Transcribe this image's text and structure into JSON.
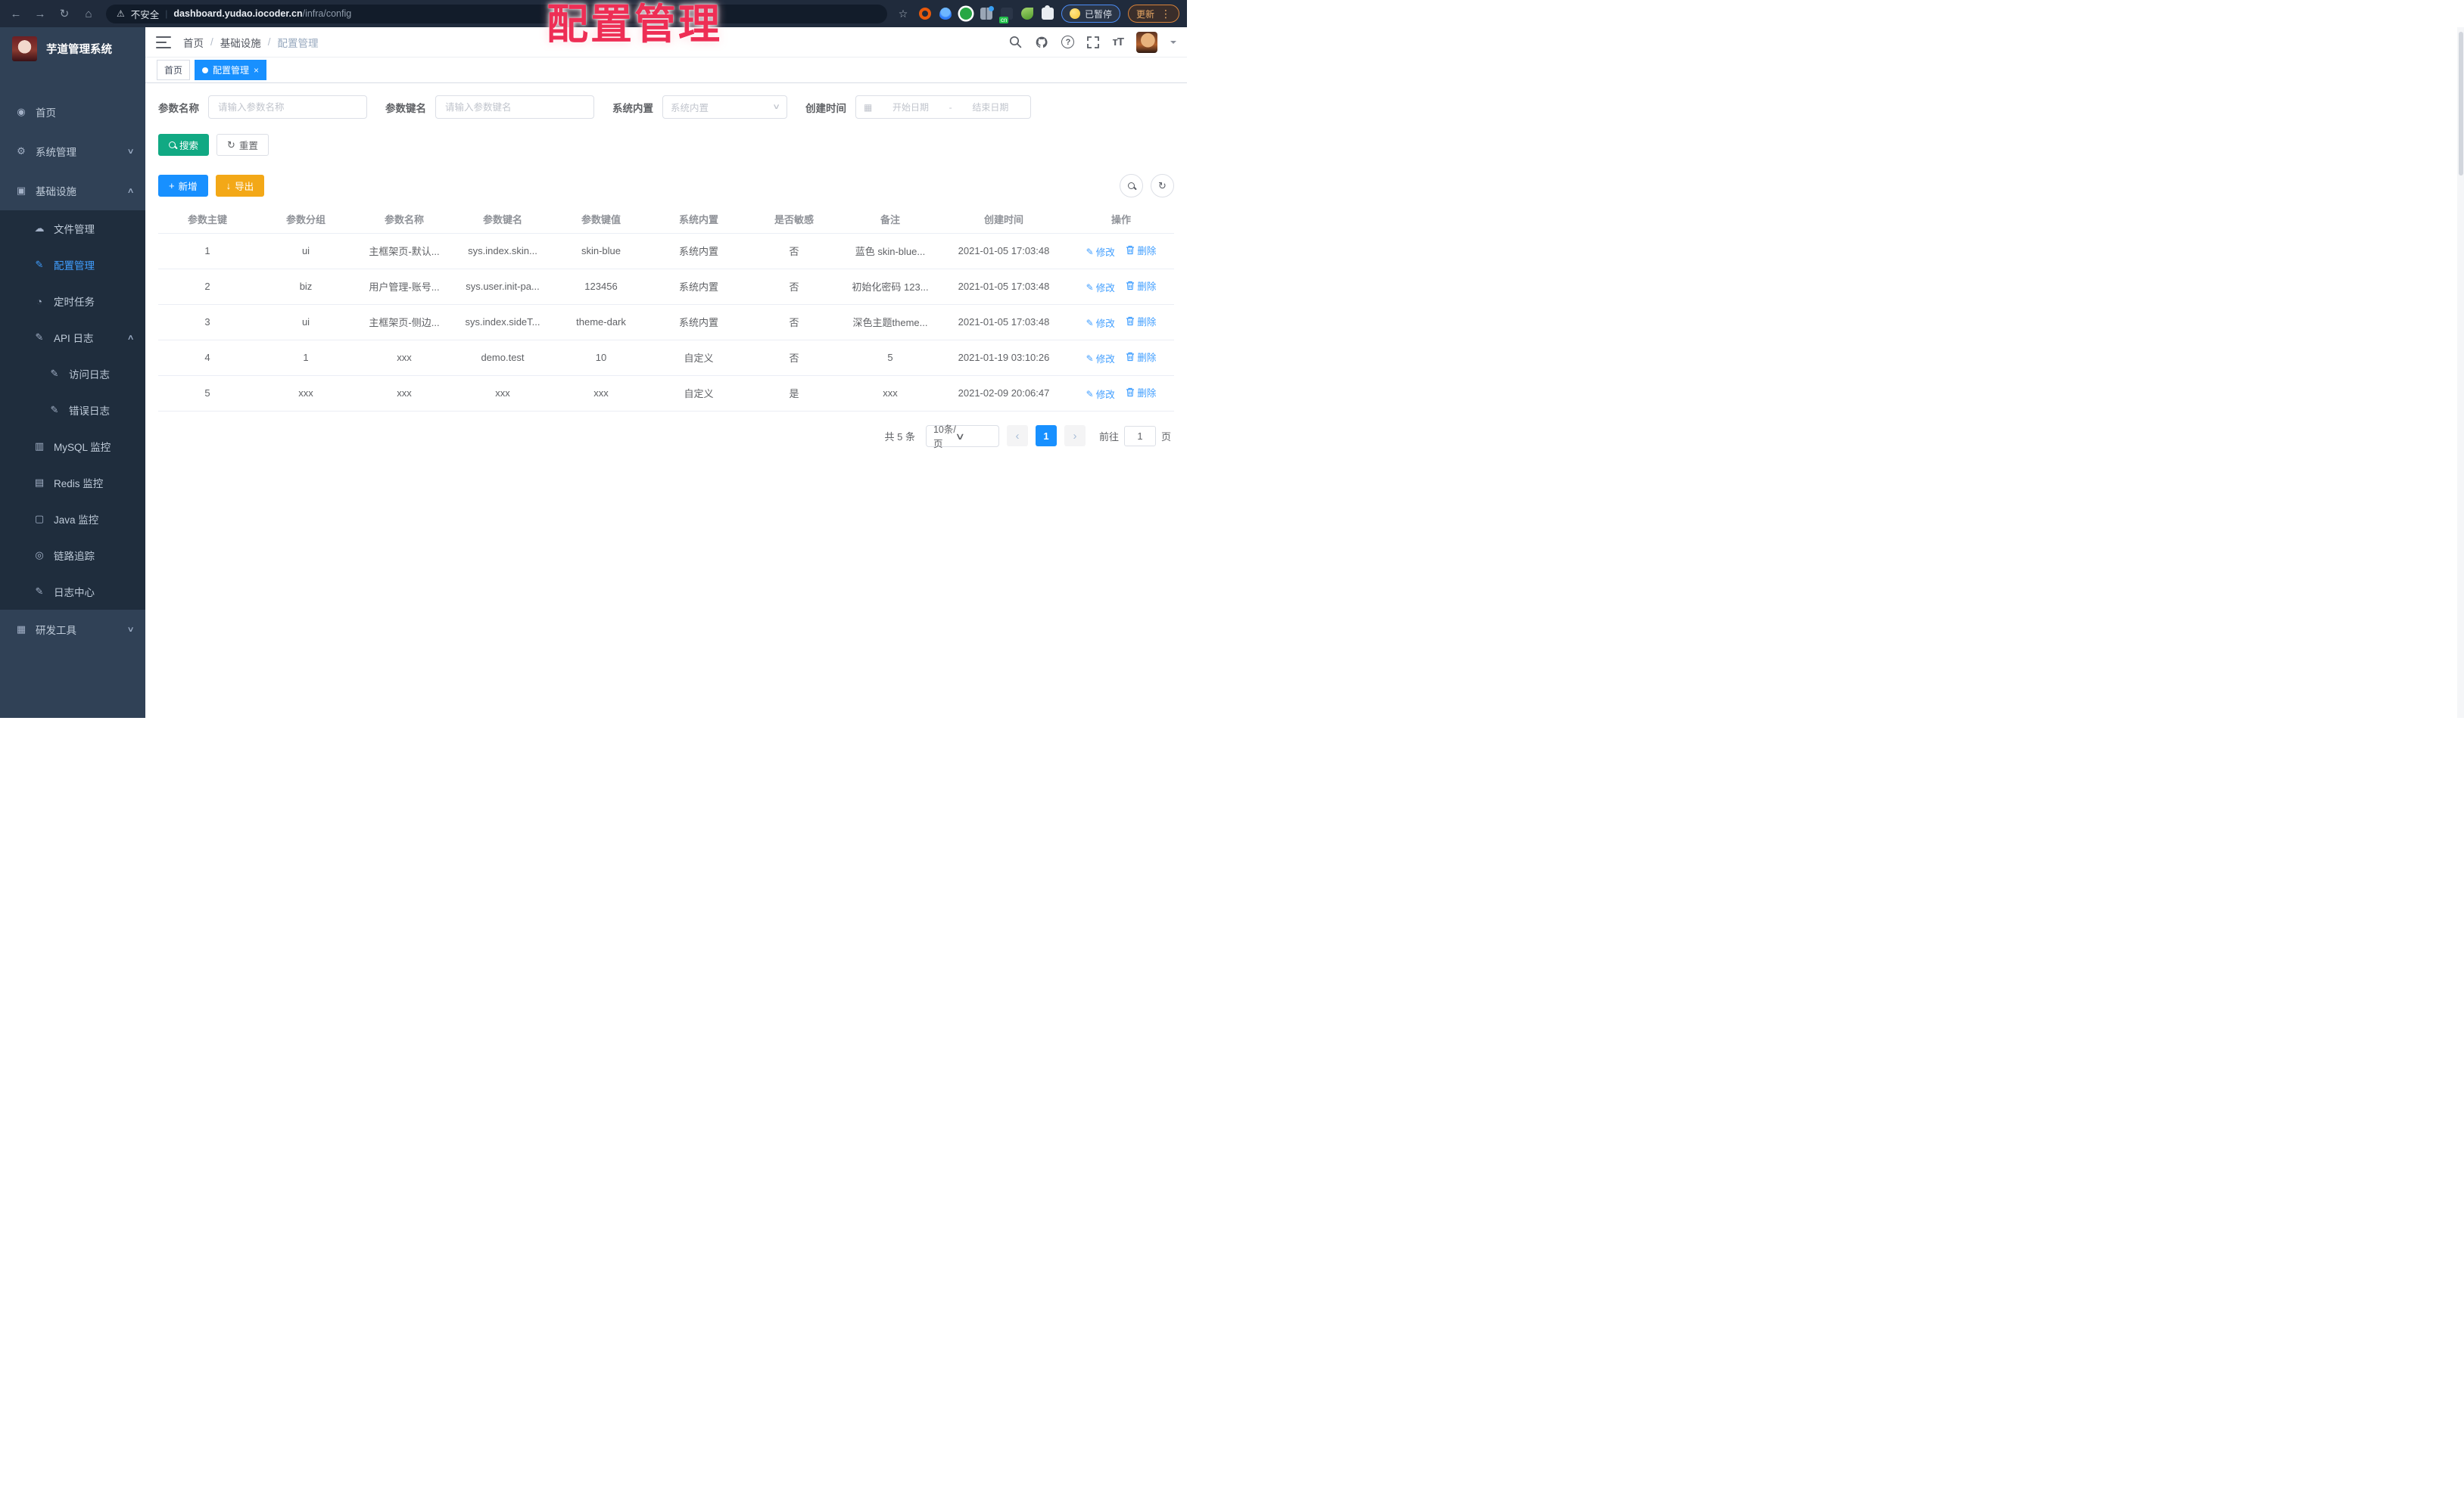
{
  "colors": {
    "accent_blue": "#409eff",
    "primary_blue": "#1890ff",
    "search_teal": "#11a983",
    "export_amber": "#f3a817",
    "sidebar_bg": "#304156",
    "submenu_bg": "#1f2d3d",
    "watermark_red": "#ee2e55"
  },
  "watermark": "配置管理",
  "browser": {
    "security_label": "不安全",
    "url_domain": "dashboard.yudao.iocoder.cn",
    "url_path": "/infra/config",
    "paused_label": "已暂停",
    "update_label": "更新"
  },
  "sidebar": {
    "title": "芋道管理系统",
    "items": [
      {
        "label": "首页"
      },
      {
        "label": "系统管理"
      },
      {
        "label": "基础设施"
      },
      {
        "label": "文件管理"
      },
      {
        "label": "配置管理"
      },
      {
        "label": "定时任务"
      },
      {
        "label": "API 日志"
      },
      {
        "label": "访问日志"
      },
      {
        "label": "错误日志"
      },
      {
        "label": "MySQL 监控"
      },
      {
        "label": "Redis 监控"
      },
      {
        "label": "Java 监控"
      },
      {
        "label": "链路追踪"
      },
      {
        "label": "日志中心"
      },
      {
        "label": "研发工具"
      }
    ]
  },
  "topbar": {
    "breadcrumb": [
      "首页",
      "基础设施",
      "配置管理"
    ],
    "sep": "/"
  },
  "tabs": {
    "home": "首页",
    "active": "配置管理"
  },
  "filters": {
    "name_label": "参数名称",
    "name_placeholder": "请输入参数名称",
    "key_label": "参数键名",
    "key_placeholder": "请输入参数键名",
    "type_label": "系统内置",
    "type_placeholder": "系统内置",
    "date_label": "创建时间",
    "date_start": "开始日期",
    "date_sep": "-",
    "date_end": "结束日期"
  },
  "buttons": {
    "search": "搜索",
    "reset": "重置",
    "add": "新增",
    "export": "导出"
  },
  "table": {
    "columns": [
      "参数主键",
      "参数分组",
      "参数名称",
      "参数键名",
      "参数键值",
      "系统内置",
      "是否敏感",
      "备注",
      "创建时间",
      "操作"
    ],
    "rows": [
      {
        "cells": [
          "1",
          "ui",
          "主框架页-默认...",
          "sys.index.skin...",
          "skin-blue",
          "系统内置",
          "否",
          "蓝色 skin-blue...",
          "2021-01-05 17:03:48"
        ],
        "edit": "修改",
        "delete": "删除"
      },
      {
        "cells": [
          "2",
          "biz",
          "用户管理-账号...",
          "sys.user.init-pa...",
          "123456",
          "系统内置",
          "否",
          "初始化密码 123...",
          "2021-01-05 17:03:48"
        ],
        "edit": "修改",
        "delete": "删除"
      },
      {
        "cells": [
          "3",
          "ui",
          "主框架页-侧边...",
          "sys.index.sideT...",
          "theme-dark",
          "系统内置",
          "否",
          "深色主题theme...",
          "2021-01-05 17:03:48"
        ],
        "edit": "修改",
        "delete": "删除"
      },
      {
        "cells": [
          "4",
          "1",
          "xxx",
          "demo.test",
          "10",
          "自定义",
          "否",
          "5",
          "2021-01-19 03:10:26"
        ],
        "edit": "修改",
        "delete": "删除"
      },
      {
        "cells": [
          "5",
          "xxx",
          "xxx",
          "xxx",
          "xxx",
          "自定义",
          "是",
          "xxx",
          "2021-02-09 20:06:47"
        ],
        "edit": "修改",
        "delete": "删除"
      }
    ]
  },
  "pagination": {
    "total": "共 5 条",
    "size": "10条/页",
    "page": "1",
    "goto_label": "前往",
    "goto_value": "1",
    "unit": "页"
  }
}
